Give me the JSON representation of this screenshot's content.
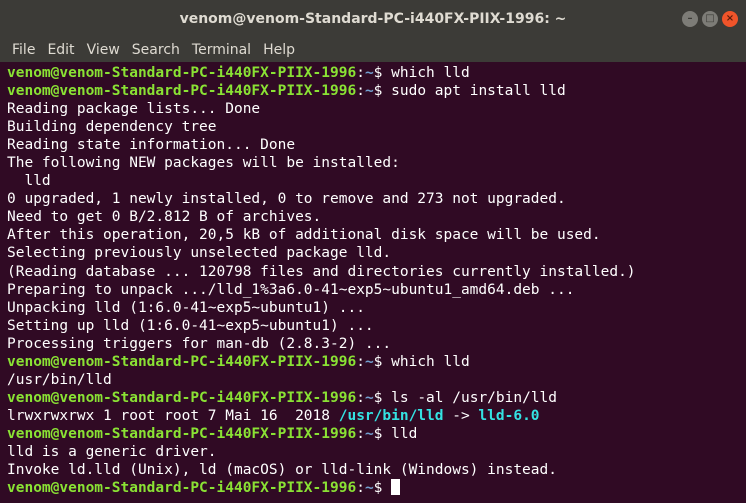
{
  "window": {
    "title": "venom@venom-Standard-PC-i440FX-PIIX-1996: ~",
    "controls": {
      "minimize": "–",
      "maximize": "□",
      "close": "×"
    }
  },
  "menu": [
    "File",
    "Edit",
    "View",
    "Search",
    "Terminal",
    "Help"
  ],
  "prompt": {
    "user_host": "venom@venom-Standard-PC-i440FX-PIIX-1996",
    "colon": ":",
    "dir": "~",
    "symbol": "$ "
  },
  "lines": [
    {
      "type": "cmd",
      "text": "which lld"
    },
    {
      "type": "cmd",
      "text": "sudo apt install lld"
    },
    {
      "type": "out",
      "text": "Reading package lists... Done"
    },
    {
      "type": "out",
      "text": "Building dependency tree"
    },
    {
      "type": "out",
      "text": "Reading state information... Done"
    },
    {
      "type": "out",
      "text": "The following NEW packages will be installed:"
    },
    {
      "type": "out",
      "text": "  lld"
    },
    {
      "type": "out",
      "text": "0 upgraded, 1 newly installed, 0 to remove and 273 not upgraded."
    },
    {
      "type": "out",
      "text": "Need to get 0 B/2.812 B of archives."
    },
    {
      "type": "out",
      "text": "After this operation, 20,5 kB of additional disk space will be used."
    },
    {
      "type": "out",
      "text": "Selecting previously unselected package lld."
    },
    {
      "type": "out",
      "text": "(Reading database ... 120798 files and directories currently installed.)"
    },
    {
      "type": "out",
      "text": "Preparing to unpack .../lld_1%3a6.0-41~exp5~ubuntu1_amd64.deb ..."
    },
    {
      "type": "out",
      "text": "Unpacking lld (1:6.0-41~exp5~ubuntu1) ..."
    },
    {
      "type": "out",
      "text": "Setting up lld (1:6.0-41~exp5~ubuntu1) ..."
    },
    {
      "type": "out",
      "text": "Processing triggers for man-db (2.8.3-2) ..."
    },
    {
      "type": "cmd",
      "text": "which lld"
    },
    {
      "type": "out",
      "text": "/usr/bin/lld"
    },
    {
      "type": "cmd",
      "text": "ls -al /usr/bin/lld"
    },
    {
      "type": "ls",
      "pre": "lrwxrwxrwx 1 root root 7 Mai 16  2018 ",
      "link": "/usr/bin/lld",
      "arrow": " -> ",
      "target": "lld-6.0"
    },
    {
      "type": "cmd",
      "text": "lld"
    },
    {
      "type": "out",
      "text": "lld is a generic driver."
    },
    {
      "type": "out",
      "text": "Invoke ld.lld (Unix), ld (macOS) or lld-link (Windows) instead."
    },
    {
      "type": "cursor",
      "text": ""
    }
  ],
  "colors": {
    "background": "#300a24",
    "prompt_user": "#8ae234",
    "prompt_dir": "#729fcf",
    "symlink": "#34e2e2",
    "titlebar": "#3c3b37"
  }
}
